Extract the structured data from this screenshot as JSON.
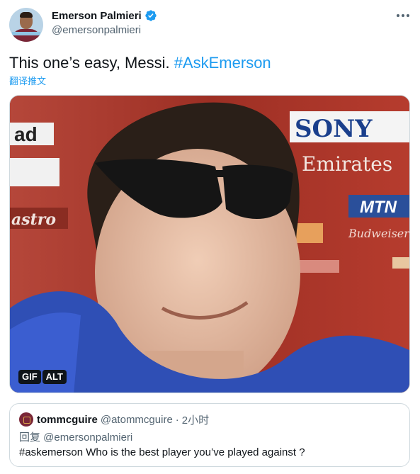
{
  "author": {
    "display_name": "Emerson Palmieri",
    "handle": "@emersonpalmieri",
    "verified": true
  },
  "tweet": {
    "text": "This one’s easy, Messi. ",
    "hashtag": "#AskEmerson",
    "translate_label": "翻译推文"
  },
  "media": {
    "type": "gif",
    "badges": [
      "GIF",
      "ALT"
    ],
    "sign_texts": [
      "SONY",
      "Emirates",
      "MTN",
      "ad",
      "astro",
      "Budweiser"
    ]
  },
  "quoted_tweet": {
    "display_name": "tommcguire",
    "handle": "@atommcguire",
    "separator": "·",
    "time": "2小时",
    "reply_to": "回复 @emersonpalmieri",
    "text": "#askemerson Who is the best player you’ve played against ?"
  },
  "colors": {
    "accent": "#1d9bf0",
    "text_primary": "#0f1419",
    "text_secondary": "#536471",
    "border": "#cfd9de"
  },
  "icons": [
    "verified-badge-icon",
    "more-options-icon"
  ]
}
